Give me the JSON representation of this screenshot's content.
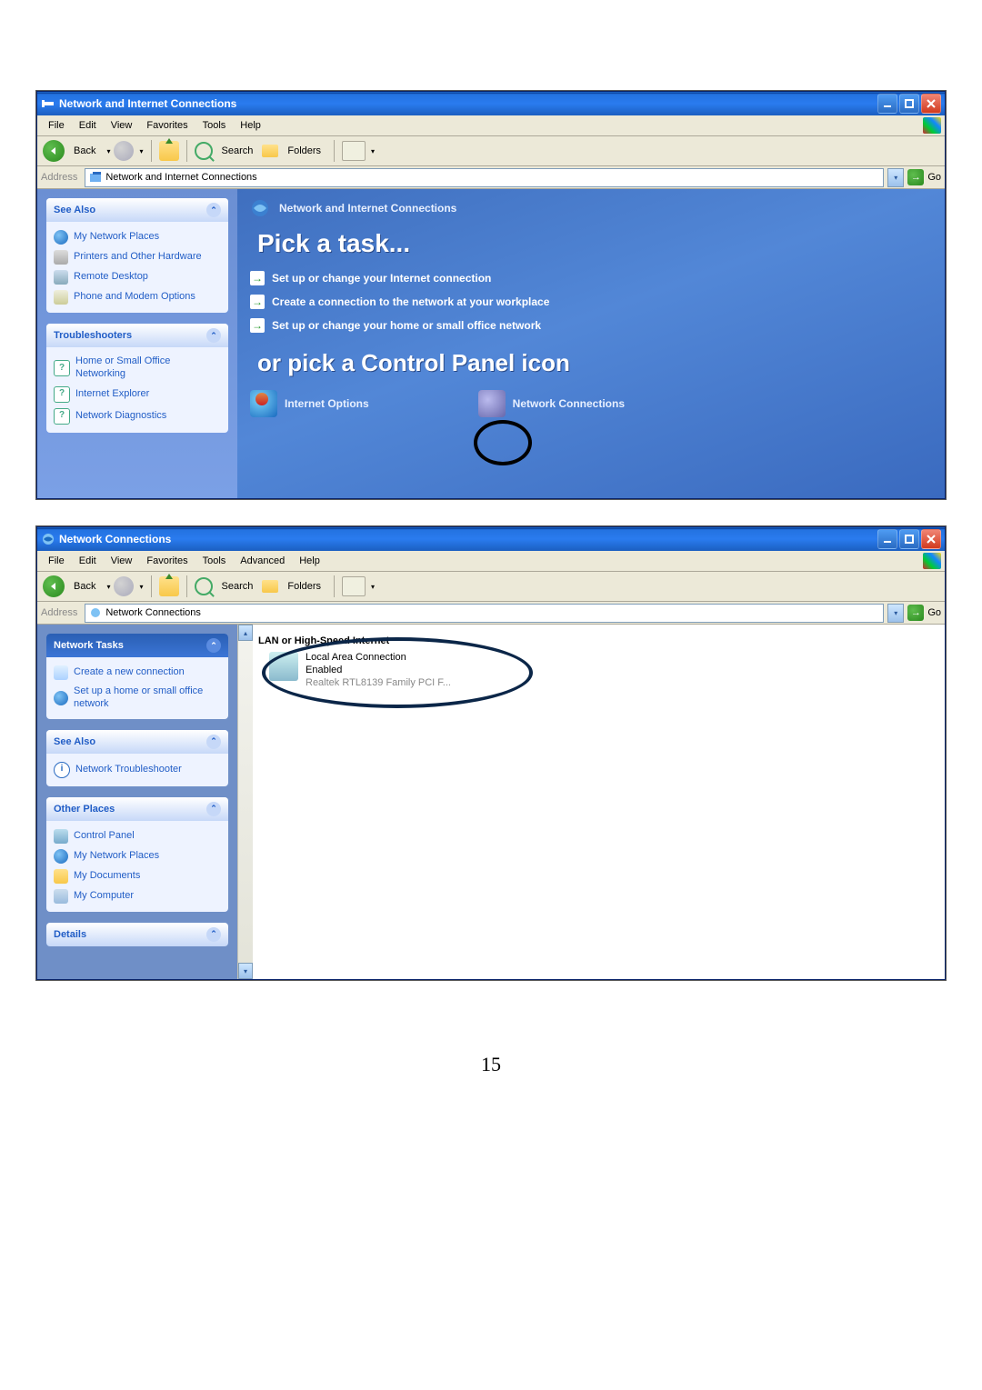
{
  "page_number": "15",
  "win1": {
    "title": "Network and Internet Connections",
    "menu": [
      "File",
      "Edit",
      "View",
      "Favorites",
      "Tools",
      "Help"
    ],
    "back": "Back",
    "search": "Search",
    "folders": "Folders",
    "addr_label": "Address",
    "addr_value": "Network and Internet Connections",
    "go": "Go",
    "sidebar": {
      "see_also": {
        "title": "See Also",
        "items": [
          "My Network Places",
          "Printers and Other Hardware",
          "Remote Desktop",
          "Phone and Modem Options"
        ]
      },
      "trouble": {
        "title": "Troubleshooters",
        "items": [
          "Home or Small Office Networking",
          "Internet Explorer",
          "Network Diagnostics"
        ]
      }
    },
    "content": {
      "category": "Network and Internet Connections",
      "pick_task": "Pick a task...",
      "tasks": [
        "Set up or change your Internet connection",
        "Create a connection to the network at your workplace",
        "Set up or change your home or small office network"
      ],
      "or_pick": "or pick a Control Panel icon",
      "icons": {
        "internet_options": "Internet Options",
        "network_connections": "Network Connections"
      }
    }
  },
  "win2": {
    "title": "Network Connections",
    "menu": [
      "File",
      "Edit",
      "View",
      "Favorites",
      "Tools",
      "Advanced",
      "Help"
    ],
    "back": "Back",
    "search": "Search",
    "folders": "Folders",
    "addr_label": "Address",
    "addr_value": "Network Connections",
    "go": "Go",
    "sidebar": {
      "net_tasks": {
        "title": "Network Tasks",
        "items": [
          "Create a new connection",
          "Set up a home or small office network"
        ]
      },
      "see_also": {
        "title": "See Also",
        "items": [
          "Network Troubleshooter"
        ]
      },
      "other_places": {
        "title": "Other Places",
        "items": [
          "Control Panel",
          "My Network Places",
          "My Documents",
          "My Computer"
        ]
      },
      "details": {
        "title": "Details"
      }
    },
    "content": {
      "section": "LAN or High-Speed Internet",
      "lan": {
        "name": "Local Area Connection",
        "status": "Enabled",
        "adapter": "Realtek RTL8139 Family PCI F..."
      }
    }
  }
}
